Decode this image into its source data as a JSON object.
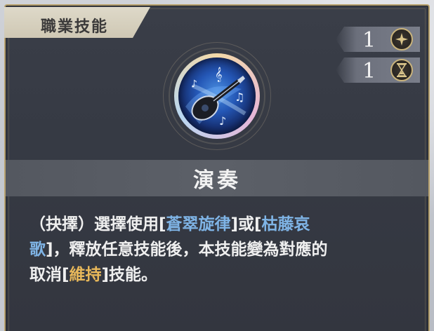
{
  "title_tab": "職業技能",
  "counters": [
    {
      "value": "1",
      "icon": "star-sparkle-icon"
    },
    {
      "value": "1",
      "icon": "hourglass-icon"
    }
  ],
  "skill": {
    "name": "演奏",
    "emblem_icon": "lute-music-icon"
  },
  "description": {
    "line1_a": "（抉擇）選擇使用[",
    "line1_b": "蒼翠旋律",
    "line1_c": "]或[",
    "line1_d": "枯藤哀",
    "line2_a": "歌",
    "line2_b": "]，釋放任意技能後，本技能變為對應的",
    "line3_a": "取消[",
    "line3_b": "維持",
    "line3_c": "]技能。"
  },
  "colors": {
    "frame_gold": "#b9a36f",
    "highlight_blue": "#7fb4e6",
    "highlight_gold": "#e8b85a"
  }
}
